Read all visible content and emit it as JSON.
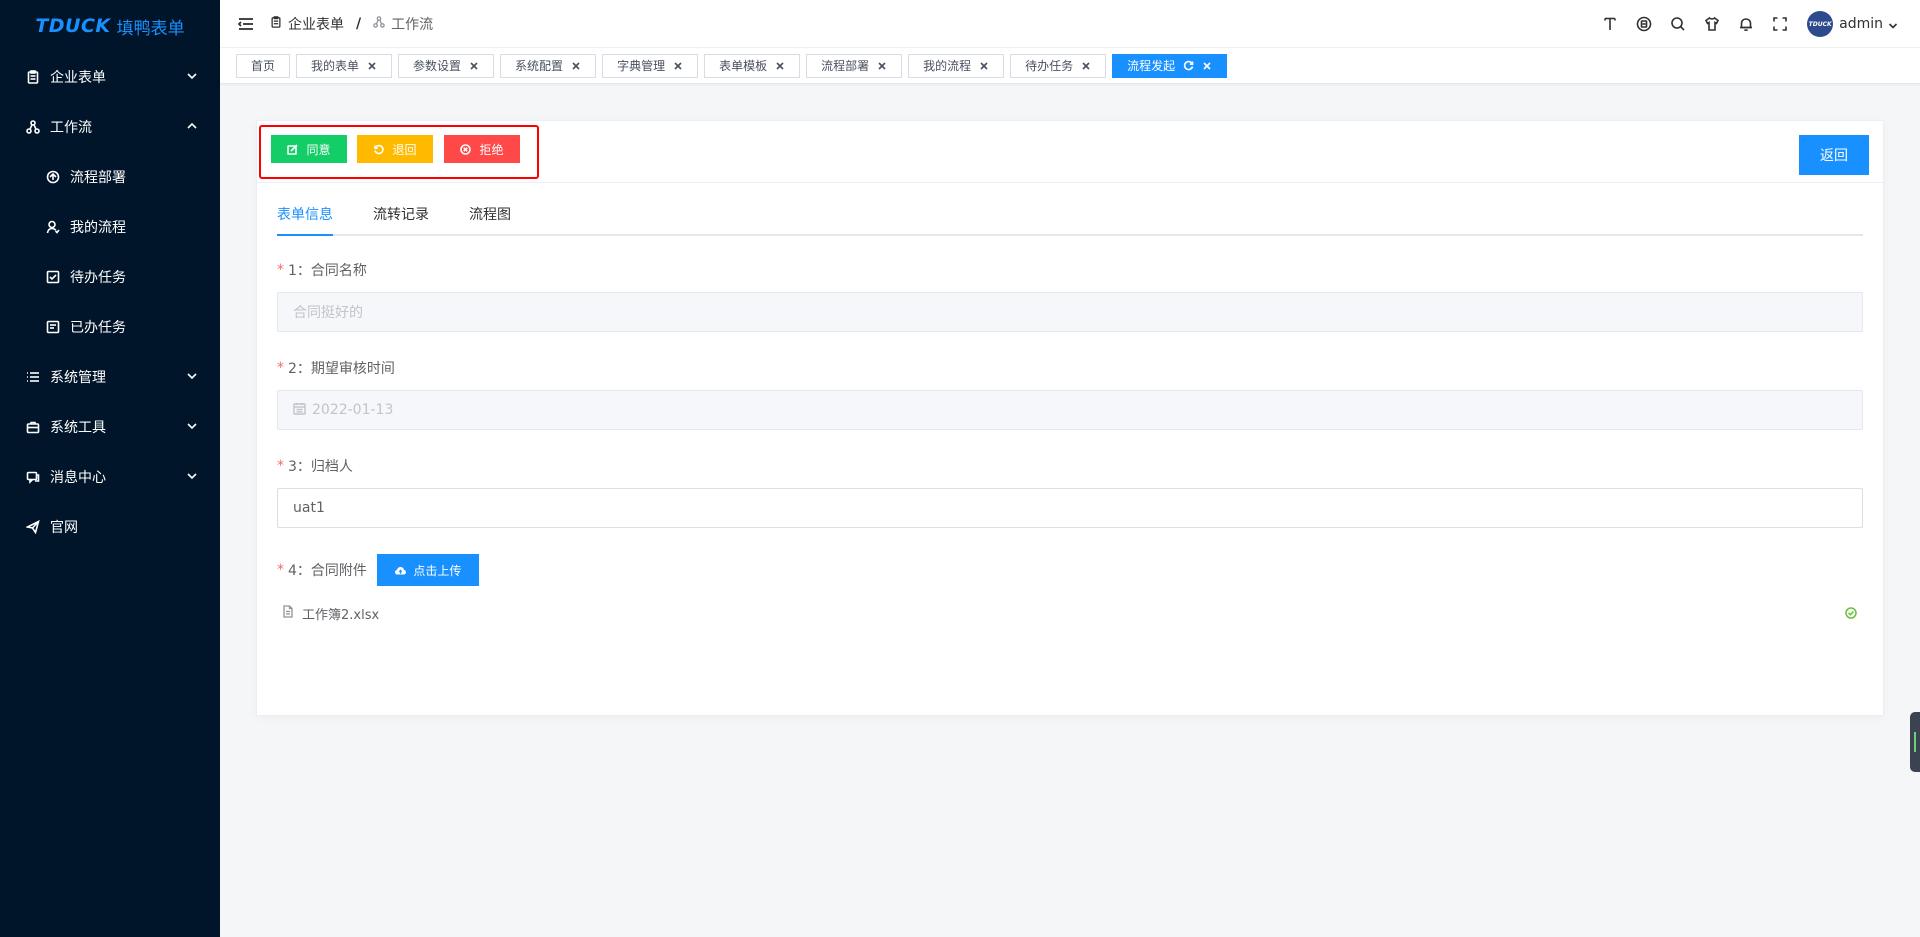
{
  "sidebar": {
    "logo_en": "TDUCK",
    "logo_cn": "填鸭表单",
    "items": [
      {
        "label": "企业表单"
      },
      {
        "label": "工作流"
      },
      {
        "label": "流程部署"
      },
      {
        "label": "我的流程"
      },
      {
        "label": "待办任务"
      },
      {
        "label": "已办任务"
      },
      {
        "label": "系统管理"
      },
      {
        "label": "系统工具"
      },
      {
        "label": "消息中心"
      },
      {
        "label": "官网"
      }
    ]
  },
  "header": {
    "breadcrumb": [
      "企业表单",
      "/",
      "工作流"
    ],
    "avatar_text": "TDUCK",
    "user": "admin"
  },
  "tags": [
    {
      "label": "首页"
    },
    {
      "label": "我的表单"
    },
    {
      "label": "参数设置"
    },
    {
      "label": "系统配置"
    },
    {
      "label": "字典管理"
    },
    {
      "label": "表单模板"
    },
    {
      "label": "流程部署"
    },
    {
      "label": "我的流程"
    },
    {
      "label": "待办任务"
    },
    {
      "label": "流程发起"
    }
  ],
  "actions": {
    "agree": "同意",
    "back": "退回",
    "reject": "拒绝",
    "return": "返回"
  },
  "tabs": [
    {
      "label": "表单信息"
    },
    {
      "label": "流转记录"
    },
    {
      "label": "流程图"
    }
  ],
  "form": {
    "f1_label": "1：合同名称",
    "f1_value": "合同挺好的",
    "f2_label": "2：期望审核时间",
    "f2_value": "2022-01-13",
    "f3_label": "3：归档人",
    "f3_value": "uat1",
    "f4_label": "4：合同附件",
    "upload_label": "点击上传",
    "file_name": "工作簿2.xlsx",
    "required_mark": "*"
  },
  "colors": {
    "primary": "#1890ff",
    "success": "#13ce66",
    "warning": "#ffba00",
    "danger": "#ff4949",
    "sidebar": "#001529"
  }
}
